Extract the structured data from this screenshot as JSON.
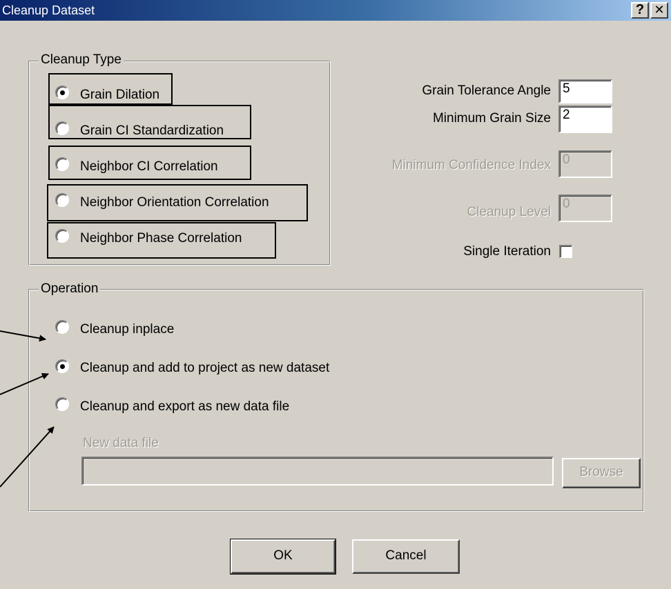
{
  "window": {
    "title": "Cleanup Dataset",
    "help_label": "?",
    "close_label": "✕"
  },
  "cleanup_type": {
    "legend": "Cleanup Type",
    "options": [
      {
        "label": "Grain Dilation",
        "selected": true
      },
      {
        "label": "Grain CI Standardization",
        "selected": false
      },
      {
        "label": "Neighbor CI Correlation",
        "selected": false
      },
      {
        "label": "Neighbor Orientation Correlation",
        "selected": false
      },
      {
        "label": "Neighbor Phase Correlation",
        "selected": false
      }
    ]
  },
  "params": {
    "grain_tolerance_angle": {
      "label": "Grain Tolerance Angle",
      "value": "5",
      "enabled": true
    },
    "minimum_grain_size": {
      "label": "Minimum Grain Size",
      "value": "2",
      "enabled": true
    },
    "minimum_confidence_index": {
      "label": "Minimum Confidence Index",
      "value": "0",
      "enabled": false
    },
    "cleanup_level": {
      "label": "Cleanup Level",
      "value": "0",
      "enabled": false
    },
    "single_iteration": {
      "label": "Single Iteration",
      "checked": false
    }
  },
  "operation": {
    "legend": "Operation",
    "options": [
      {
        "label": "Cleanup inplace",
        "selected": false
      },
      {
        "label": "Cleanup and add to project as new dataset",
        "selected": true
      },
      {
        "label": "Cleanup and export as new data file",
        "selected": false
      }
    ],
    "new_data_file": {
      "label": "New data file",
      "value": "",
      "enabled": false
    },
    "browse_label": "Browse"
  },
  "buttons": {
    "ok_label": "OK",
    "cancel_label": "Cancel"
  },
  "colors": {
    "dialog_bg": "#d4d0c8",
    "titlebar_start": "#0a246a",
    "titlebar_end": "#a6caf0",
    "disabled_text": "#a09c94"
  }
}
